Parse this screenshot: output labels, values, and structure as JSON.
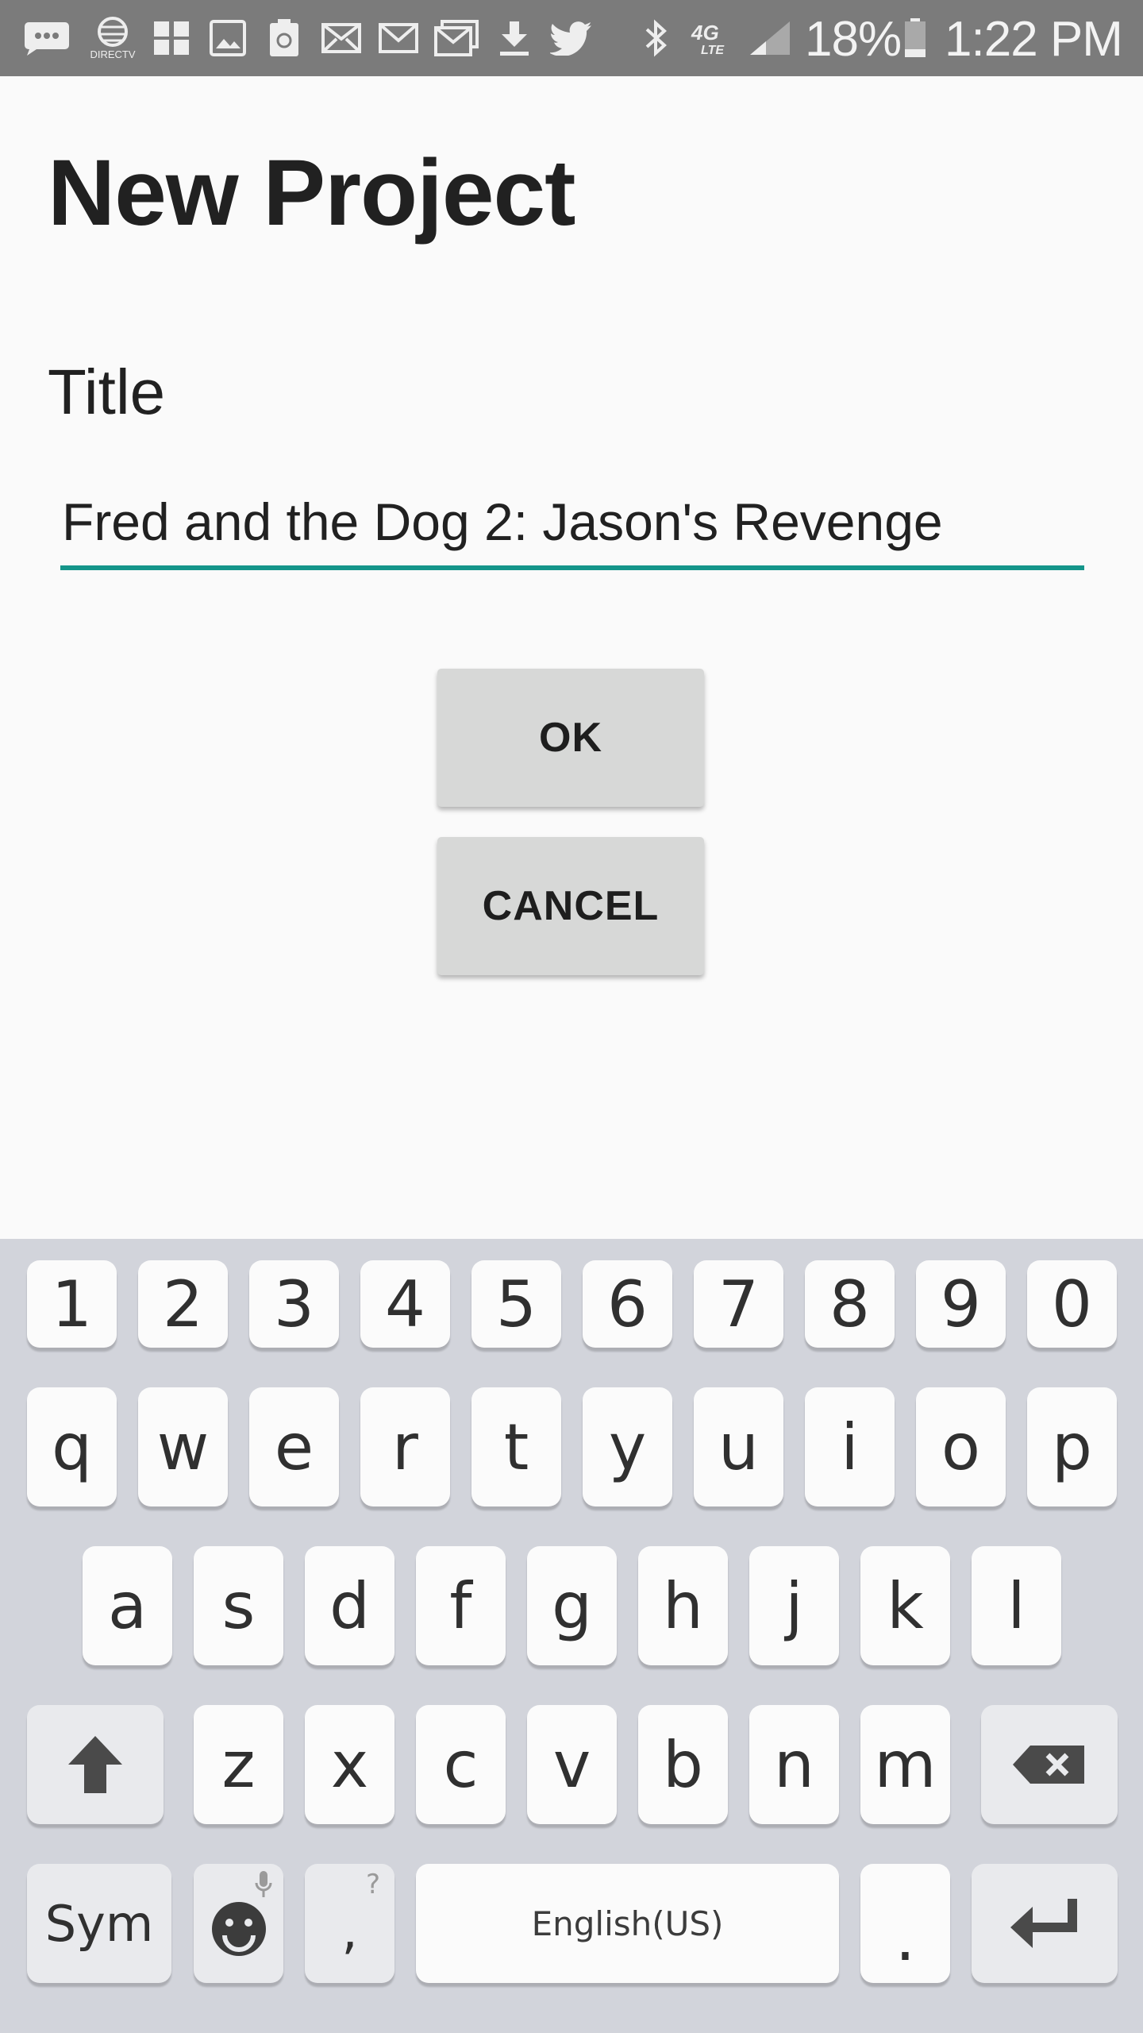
{
  "status_bar": {
    "battery": "18%",
    "time": "1:22 PM",
    "left_icons": [
      "chat-bubble-icon",
      "directv-icon",
      "calendar-grid-icon",
      "image-icon",
      "recycle-icon",
      "email-icon",
      "gmail-icon",
      "gmail-stack-icon",
      "download-icon",
      "twitter-icon"
    ],
    "right_icons": [
      "bluetooth-icon",
      "4g-lte-icon",
      "signal-icon",
      "battery-icon"
    ],
    "directv_label": "DIRECTV",
    "lte_label": "4G LTE"
  },
  "form": {
    "heading": "New Project",
    "title_label": "Title",
    "title_value": "Fred and the Dog 2: Jason's Revenge",
    "accent_color": "#14958a",
    "ok_label": "OK",
    "cancel_label": "CANCEL"
  },
  "keyboard": {
    "numbers": [
      "1",
      "2",
      "3",
      "4",
      "5",
      "6",
      "7",
      "8",
      "9",
      "0"
    ],
    "row1": [
      "q",
      "w",
      "e",
      "r",
      "t",
      "y",
      "u",
      "i",
      "o",
      "p"
    ],
    "row2": [
      "a",
      "s",
      "d",
      "f",
      "g",
      "h",
      "j",
      "k",
      "l"
    ],
    "row3": [
      "z",
      "x",
      "c",
      "v",
      "b",
      "n",
      "m"
    ],
    "sym_label": "Sym",
    "comma": ",",
    "comma_hint": "?",
    "space_label": "English(US)",
    "period": "."
  }
}
